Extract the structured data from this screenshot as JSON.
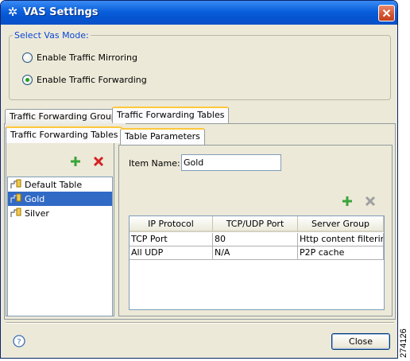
{
  "window": {
    "title": "VAS Settings",
    "icon": "cisco-logo-icon"
  },
  "mode_group": {
    "legend": "Select Vas Mode:",
    "options": [
      {
        "label": "Enable Traffic Mirroring",
        "checked": false
      },
      {
        "label": "Enable Traffic Forwarding",
        "checked": true
      }
    ]
  },
  "main_tabs": [
    {
      "label": "Traffic Forwarding Groups",
      "active": false
    },
    {
      "label": "Traffic Forwarding Tables",
      "active": true
    }
  ],
  "tables_pane": {
    "tab_label": "Traffic Forwarding Tables",
    "items": [
      {
        "label": "Default Table",
        "selected": false
      },
      {
        "label": "Gold",
        "selected": true
      },
      {
        "label": "Silver",
        "selected": false
      }
    ]
  },
  "params_pane": {
    "tab_label": "Table Parameters",
    "item_name_label": "Item Name:",
    "item_name_value": "Gold",
    "columns": [
      "IP Protocol",
      "TCP/UDP Port",
      "Server Group"
    ],
    "rows": [
      [
        "TCP Port",
        "80",
        "Http content filtering"
      ],
      [
        "All UDP",
        "N/A",
        "P2P cache"
      ]
    ]
  },
  "footer": {
    "close_label": "Close"
  },
  "side_number": "274126",
  "colors": {
    "titlebar": "#0a5fdb",
    "selection": "#316ac5",
    "legend_text": "#0a46d5",
    "add_green": "#3aa43a",
    "delete_red": "#d42222"
  }
}
